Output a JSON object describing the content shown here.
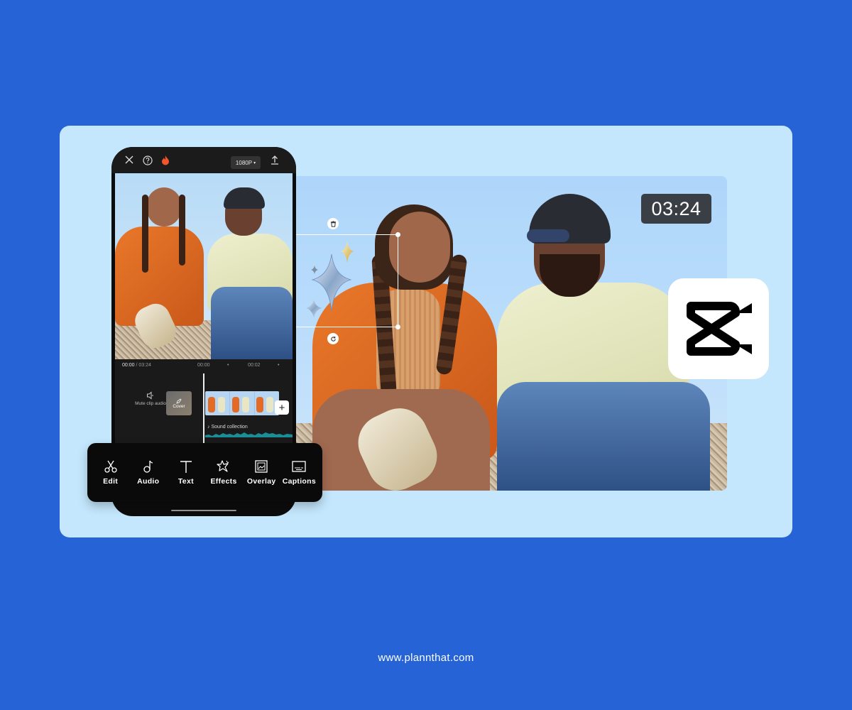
{
  "brand": {
    "background_color": "#2563d6",
    "panel_color": "#c4e7fd",
    "app_logo": "capcut-logo-icon"
  },
  "phone": {
    "topbar": {
      "close_icon": "close-icon",
      "help_icon": "help-icon",
      "flame_icon": "flame-icon",
      "resolution_label": "1080P",
      "export_icon": "upload-icon"
    },
    "editor": {
      "current_time": "00:00",
      "total_time": "03:24",
      "time_separator": "/",
      "ruler_ticks": [
        "00:00",
        "•",
        "00:02",
        "•"
      ],
      "mute_label": "Mute clip audio",
      "cover_label": "Cover",
      "add_label": "+",
      "sound_label": "Sound collection"
    }
  },
  "toolbar": {
    "items": [
      {
        "label": "Edit",
        "icon": "scissors-icon"
      },
      {
        "label": "Audio",
        "icon": "music-note-icon"
      },
      {
        "label": "Text",
        "icon": "text-icon"
      },
      {
        "label": "Effects",
        "icon": "star-effects-icon"
      },
      {
        "label": "Overlay",
        "icon": "overlay-icon"
      },
      {
        "label": "Captions",
        "icon": "captions-icon"
      }
    ]
  },
  "preview": {
    "duration_badge": "03:24",
    "sticker_delete_icon": "trash-icon",
    "sticker_rotate_icon": "rotate-icon"
  },
  "footer": {
    "url": "www.plannthat.com"
  }
}
